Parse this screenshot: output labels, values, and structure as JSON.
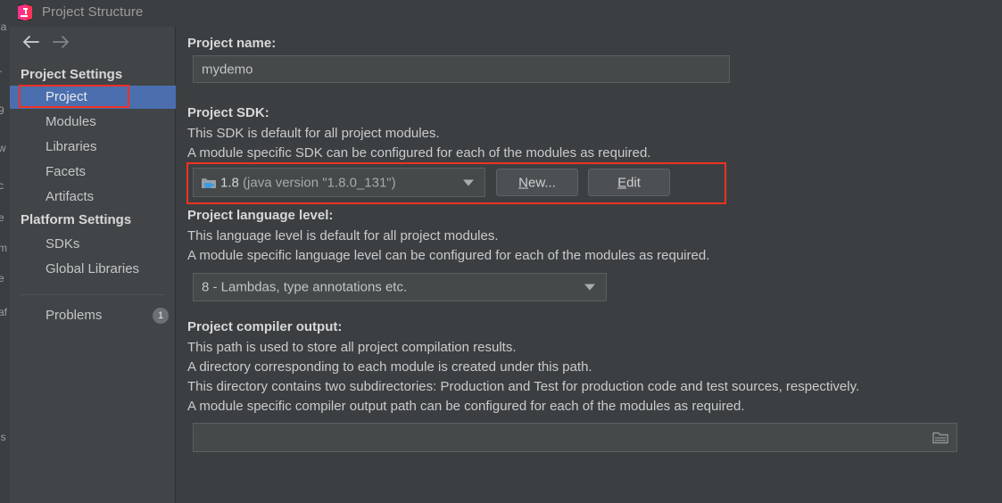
{
  "window": {
    "title": "Project Structure",
    "app_icon": "intellij-idea-icon"
  },
  "background_fragments": [
    "la",
    "r",
    "9",
    "w",
    "c",
    "e",
    "m",
    "e",
    "af",
    "is"
  ],
  "sidebar": {
    "back_button": "back-arrow",
    "forward_button": "forward-arrow",
    "groups": [
      {
        "heading": "Project Settings",
        "items": [
          {
            "label": "Project",
            "selected": true
          },
          {
            "label": "Modules",
            "selected": false
          },
          {
            "label": "Libraries",
            "selected": false
          },
          {
            "label": "Facets",
            "selected": false
          },
          {
            "label": "Artifacts",
            "selected": false
          }
        ]
      },
      {
        "heading": "Platform Settings",
        "items": [
          {
            "label": "SDKs",
            "selected": false
          },
          {
            "label": "Global Libraries",
            "selected": false
          }
        ]
      }
    ],
    "problems": {
      "label": "Problems",
      "badge": "1"
    }
  },
  "main": {
    "project_name": {
      "label": "Project name:",
      "value": "mydemo"
    },
    "project_sdk": {
      "label": "Project SDK:",
      "description_line1": "This SDK is default for all project modules.",
      "description_line2": "A module specific SDK can be configured for each of the modules as required.",
      "selected": "1.8 (java version \"1.8.0_131\")",
      "selected_version": "1.8",
      "selected_detail": "(java version \"1.8.0_131\")",
      "new_button": "New...",
      "new_button_mnemonic": "N",
      "edit_button": "Edit",
      "edit_button_mnemonic": "E"
    },
    "language_level": {
      "label": "Project language level:",
      "description_line1": "This language level is default for all project modules.",
      "description_line2": "A module specific language level can be configured for each of the modules as required.",
      "selected": "8 - Lambdas, type annotations etc."
    },
    "compiler_output": {
      "label": "Project compiler output:",
      "description_line1": "This path is used to store all project compilation results.",
      "description_line2": "A directory corresponding to each module is created under this path.",
      "description_line3": "This directory contains two subdirectories: Production and Test for production code and test sources, respectively.",
      "description_line4": "A module specific compiler output path can be configured for each of the modules as required.",
      "value": "",
      "browse_icon": "folder-icon"
    }
  },
  "annotations": {
    "highlight_color": "#ef3124",
    "boxes": [
      {
        "name": "project-item-highlight"
      },
      {
        "name": "project-sdk-row-highlight"
      }
    ]
  },
  "colors": {
    "window_bg": "#3c3f41",
    "sidebar_bg": "#414547",
    "selection_blue": "#4b6eaf",
    "field_bg": "#45494a",
    "text_primary": "#c9cbcd",
    "text_heading": "#d6d8da"
  }
}
